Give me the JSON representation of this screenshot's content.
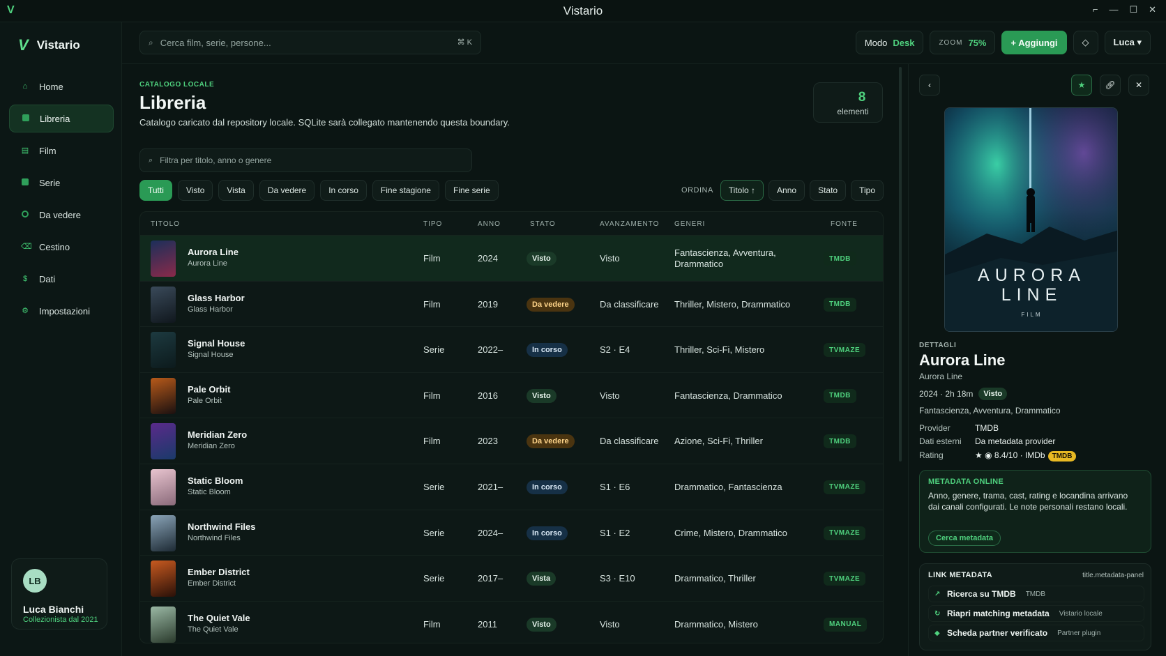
{
  "window": {
    "title": "Vistario",
    "controls": [
      "⌐",
      "—",
      "☐",
      "✕"
    ]
  },
  "sidebar": {
    "brand": "Vistario",
    "items": [
      {
        "label": "Home",
        "icon": "home-icon",
        "active": false
      },
      {
        "label": "Libreria",
        "icon": "library-icon",
        "active": true
      },
      {
        "label": "Film",
        "icon": "film-icon",
        "active": false
      },
      {
        "label": "Serie",
        "icon": "series-icon",
        "active": false
      },
      {
        "label": "Da vedere",
        "icon": "watchlist-icon",
        "active": false
      },
      {
        "label": "Cestino",
        "icon": "trash-icon",
        "active": false
      },
      {
        "label": "Dati",
        "icon": "data-icon",
        "active": false
      },
      {
        "label": "Impostazioni",
        "icon": "settings-icon",
        "active": false
      }
    ],
    "profile": {
      "initials": "LB",
      "name": "Luca Bianchi",
      "since": "Collezionista dal 2021"
    }
  },
  "topbar": {
    "search_placeholder": "Cerca film, serie, persone...",
    "shortcut": "⌘ K",
    "mode_label": "Modo",
    "mode_value": "Desk",
    "zoom_label": "ZOOM",
    "zoom_value": "75%",
    "add_label": "+ Aggiungi",
    "user_label": "Luca ▾"
  },
  "page": {
    "kicker": "CATALOGO LOCALE",
    "title": "Libreria",
    "description": "Catalogo caricato dal repository locale. SQLite sarà collegato mantenendo questa boundary.",
    "count": "8",
    "count_label": "elementi",
    "filter_placeholder": "Filtra per titolo, anno o genere",
    "chips": [
      "Tutti",
      "Visto",
      "Vista",
      "Da vedere",
      "In corso",
      "Fine stagione",
      "Fine serie"
    ],
    "sort_label": "ORDINA",
    "sort_options": [
      "Titolo ↑",
      "Anno",
      "Stato",
      "Tipo"
    ]
  },
  "table": {
    "headers": {
      "title": "TITOLO",
      "type": "TIPO",
      "year": "ANNO",
      "status": "STATO",
      "progress": "AVANZAMENTO",
      "genres": "GENERI",
      "source": "FONTE"
    },
    "rows": [
      {
        "title": "Aurora Line",
        "subtitle": "Aurora Line",
        "type": "Film",
        "year": "2024",
        "status": "Visto",
        "status_kind": "visto",
        "progress": "Visto",
        "genres": "Fantascienza, Avventura, Drammatico",
        "source": "TMDB",
        "colors": [
          "#1b2f5a",
          "#8a2a4a"
        ]
      },
      {
        "title": "Glass Harbor",
        "subtitle": "Glass Harbor",
        "type": "Film",
        "year": "2019",
        "status": "Da vedere",
        "status_kind": "dav",
        "progress": "Da classificare",
        "genres": "Thriller, Mistero, Drammatico",
        "source": "TMDB",
        "colors": [
          "#3a4a5a",
          "#10171d"
        ]
      },
      {
        "title": "Signal House",
        "subtitle": "Signal House",
        "type": "Serie",
        "year": "2022–",
        "status": "In corso",
        "status_kind": "inc",
        "progress": "S2 · E4",
        "genres": "Thriller, Sci-Fi, Mistero",
        "source": "TVMAZE",
        "colors": [
          "#1d3a40",
          "#0c1a1c"
        ]
      },
      {
        "title": "Pale Orbit",
        "subtitle": "Pale Orbit",
        "type": "Film",
        "year": "2016",
        "status": "Visto",
        "status_kind": "visto",
        "progress": "Visto",
        "genres": "Fantascienza, Drammatico",
        "source": "TMDB",
        "colors": [
          "#b85a1a",
          "#1a1010"
        ]
      },
      {
        "title": "Meridian Zero",
        "subtitle": "Meridian Zero",
        "type": "Film",
        "year": "2023",
        "status": "Da vedere",
        "status_kind": "dav",
        "progress": "Da classificare",
        "genres": "Azione, Sci-Fi, Thriller",
        "source": "TMDB",
        "colors": [
          "#5a2a8a",
          "#1a3a6a"
        ]
      },
      {
        "title": "Static Bloom",
        "subtitle": "Static Bloom",
        "type": "Serie",
        "year": "2021–",
        "status": "In corso",
        "status_kind": "inc",
        "progress": "S1 · E6",
        "genres": "Drammatico, Fantascienza",
        "source": "TVMAZE",
        "colors": [
          "#e8c4cf",
          "#8a6a7a"
        ]
      },
      {
        "title": "Northwind Files",
        "subtitle": "Northwind Files",
        "type": "Serie",
        "year": "2024–",
        "status": "In corso",
        "status_kind": "inc",
        "progress": "S1 · E2",
        "genres": "Crime, Mistero, Drammatico",
        "source": "TVMAZE",
        "colors": [
          "#8aa4b8",
          "#1d2a34"
        ]
      },
      {
        "title": "Ember District",
        "subtitle": "Ember District",
        "type": "Serie",
        "year": "2017–",
        "status": "Vista",
        "status_kind": "visto",
        "progress": "S3 · E10",
        "genres": "Drammatico, Thriller",
        "source": "TVMAZE",
        "colors": [
          "#c85a20",
          "#2a1008"
        ]
      },
      {
        "title": "The Quiet Vale",
        "subtitle": "The Quiet Vale",
        "type": "Film",
        "year": "2011",
        "status": "Visto",
        "status_kind": "visto",
        "progress": "Visto",
        "genres": "Drammatico, Mistero",
        "source": "MANUAL",
        "colors": [
          "#9ab8a4",
          "#2a3a2c"
        ]
      }
    ]
  },
  "detail": {
    "kicker": "DETTAGLI",
    "title": "Aurora Line",
    "subtitle": "Aurora Line",
    "meta": "2024 · 2h 18m",
    "status": "Visto",
    "genres": "Fantascienza, Avventura, Drammatico",
    "provider_label": "Provider",
    "provider_value": "TMDB",
    "external_label": "Dati esterni",
    "external_value": "Da metadata provider",
    "rating_label": "Rating",
    "rating_value": "★ ◉ 8.4/10 · IMDb",
    "rating_badge": "TMDB",
    "poster_word1": "AURORA",
    "poster_word2": "LINE",
    "poster_word3": "FILM",
    "metadata_online": {
      "heading": "METADATA ONLINE",
      "text": "Anno, genere, trama, cast, rating e locandina arrivano dai canali configurati. Le note personali restano locali.",
      "button": "Cerca metadata"
    },
    "links": {
      "heading": "LINK METADATA",
      "ref": "title.metadata-panel",
      "items": [
        {
          "label": "Ricerca su TMDB",
          "sub": "TMDB",
          "icon": "↗"
        },
        {
          "label": "Riapri matching metadata",
          "sub": "Vistario locale",
          "icon": "↻"
        },
        {
          "label": "Scheda partner verificato",
          "sub": "Partner plugin",
          "icon": "◆"
        }
      ]
    }
  }
}
